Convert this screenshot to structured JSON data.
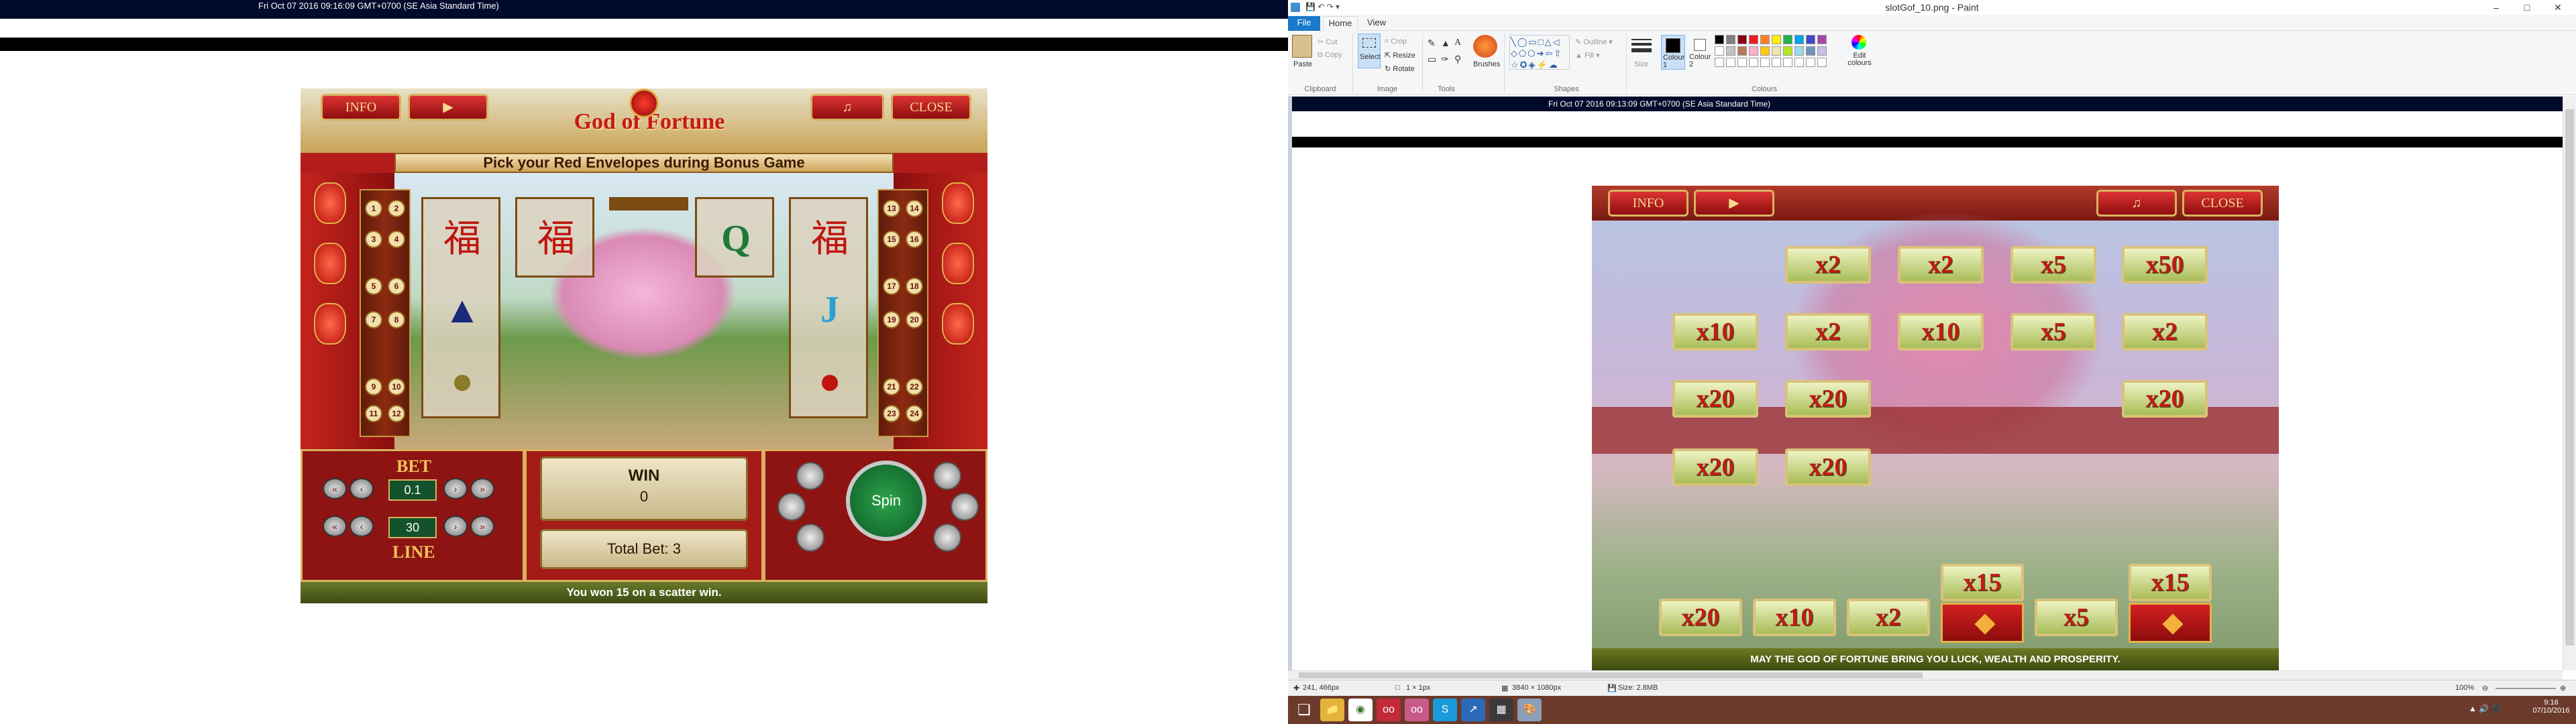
{
  "left_browser": {
    "timestamp": "Fri Oct 07 2016 09:16:09 GMT+0700 (SE Asia Standard Time)"
  },
  "game": {
    "info_label": "INFO",
    "paytable_label": "",
    "sound_icon": "music-note-icon",
    "close_label": "CLOSE",
    "logo_text": "God of Fortune",
    "banner": "Pick your Red Envelopes during Bonus Game",
    "bet_label": "BET",
    "bet_value": "0.1",
    "line_label": "LINE",
    "line_value": "30",
    "win_label": "WIN",
    "win_value": "0",
    "total_bet": "Total Bet: 3",
    "spin_label": "Spin",
    "status": "You won 15 on a scatter win.",
    "reel_symbols": [
      [
        "lantern-fu",
        "shoe-ingot",
        "frog"
      ],
      [
        "lantern-fu",
        "",
        ""
      ],
      [
        "",
        "",
        ""
      ],
      [
        "Q",
        "",
        ""
      ],
      [
        "scroll-fu",
        "wave-j",
        "lantern"
      ]
    ]
  },
  "paint": {
    "title": "slotGof_10.png - Paint",
    "menu": {
      "file": "File",
      "home": "Home",
      "view": "View"
    },
    "ribbon": {
      "paste": "Paste",
      "cut": "Cut",
      "copy": "Copy",
      "clipboard": "Clipboard",
      "select": "Select",
      "crop": "Crop",
      "resize": "Resize",
      "rotate": "Rotate",
      "image": "Image",
      "tools": "Tools",
      "brushes": "Brushes",
      "shapes": "Shapes",
      "outline": "Outline",
      "fill": "Fill",
      "size": "Size",
      "colour1": "Colour 1",
      "colour2": "Colour 2",
      "colours": "Colours",
      "edit_colours": "Edit colours"
    },
    "palette": [
      "#000000",
      "#7f7f7f",
      "#880015",
      "#ed1c24",
      "#ff7f27",
      "#fff200",
      "#22b14c",
      "#00a2e8",
      "#3f48cc",
      "#a349a4",
      "#ffffff",
      "#c3c3c3",
      "#b97a57",
      "#ffaec9",
      "#ffc90e",
      "#efe4b0",
      "#b5e61d",
      "#99d9ea",
      "#7092be",
      "#c8bfe7"
    ],
    "inner_timestamp": "Fri Oct 07 2016 09:13:09 GMT+0700 (SE Asia Standard Time)",
    "bonus": {
      "info_label": "INFO",
      "close_label": "CLOSE",
      "rows": [
        [
          "",
          "x2",
          "x2",
          "x5",
          "x50"
        ],
        [
          "x10",
          "x2",
          "x10",
          "x5",
          "x2"
        ],
        [
          "x20",
          "x20",
          "",
          "",
          "x20"
        ],
        [
          "x20",
          "x20",
          "",
          "",
          ""
        ]
      ],
      "bottom_row": [
        "x20",
        "x10",
        "x2",
        "x15",
        "x5",
        "x15"
      ],
      "footer": "MAY THE GOD OF FORTUNE BRING YOU LUCK, WEALTH AND PROSPERITY."
    },
    "status": {
      "cursor": "241, 466px",
      "selection": "1 × 1px",
      "dimensions": "3840 × 1080px",
      "size": "Size: 2.8MB",
      "zoom": "100%"
    },
    "taskbar": {
      "time": "9:16",
      "date": "07/10/2016"
    }
  }
}
